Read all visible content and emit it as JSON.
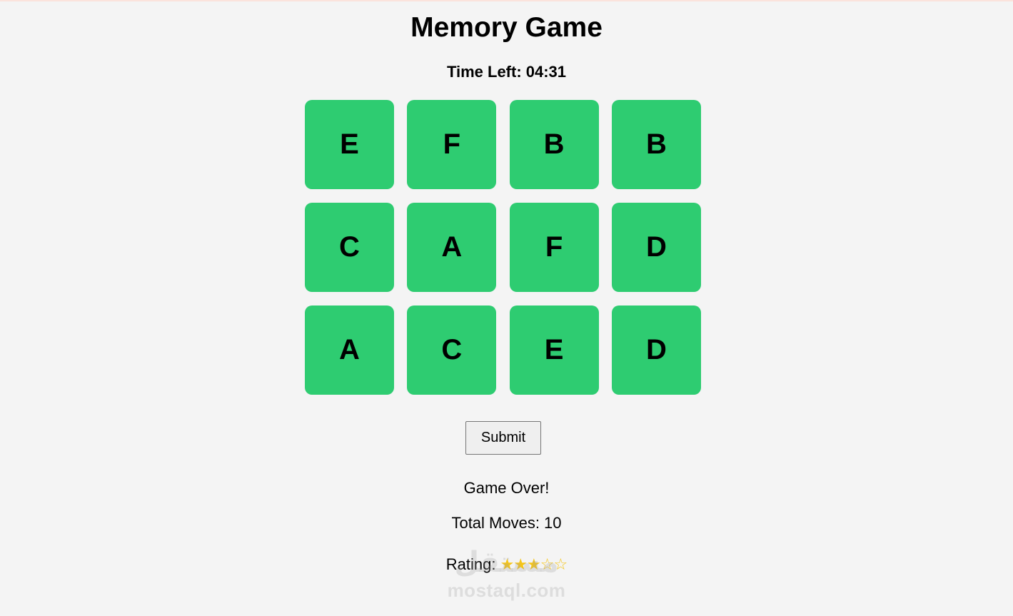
{
  "header": {
    "title": "Memory Game",
    "timer": "Time Left: 04:31"
  },
  "board": {
    "card_color": "#2ecc71",
    "cards": [
      "E",
      "F",
      "B",
      "B",
      "C",
      "A",
      "F",
      "D",
      "A",
      "C",
      "E",
      "D"
    ]
  },
  "controls": {
    "submit_label": "Submit"
  },
  "result": {
    "message": "Game Over!",
    "moves": "Total Moves: 10",
    "rating_label": "Rating:",
    "rating_stars": "★★★☆☆",
    "rating_value": 3,
    "rating_max": 5
  },
  "watermark": {
    "arabic": "مستقل",
    "latin": "mostaql.com"
  }
}
